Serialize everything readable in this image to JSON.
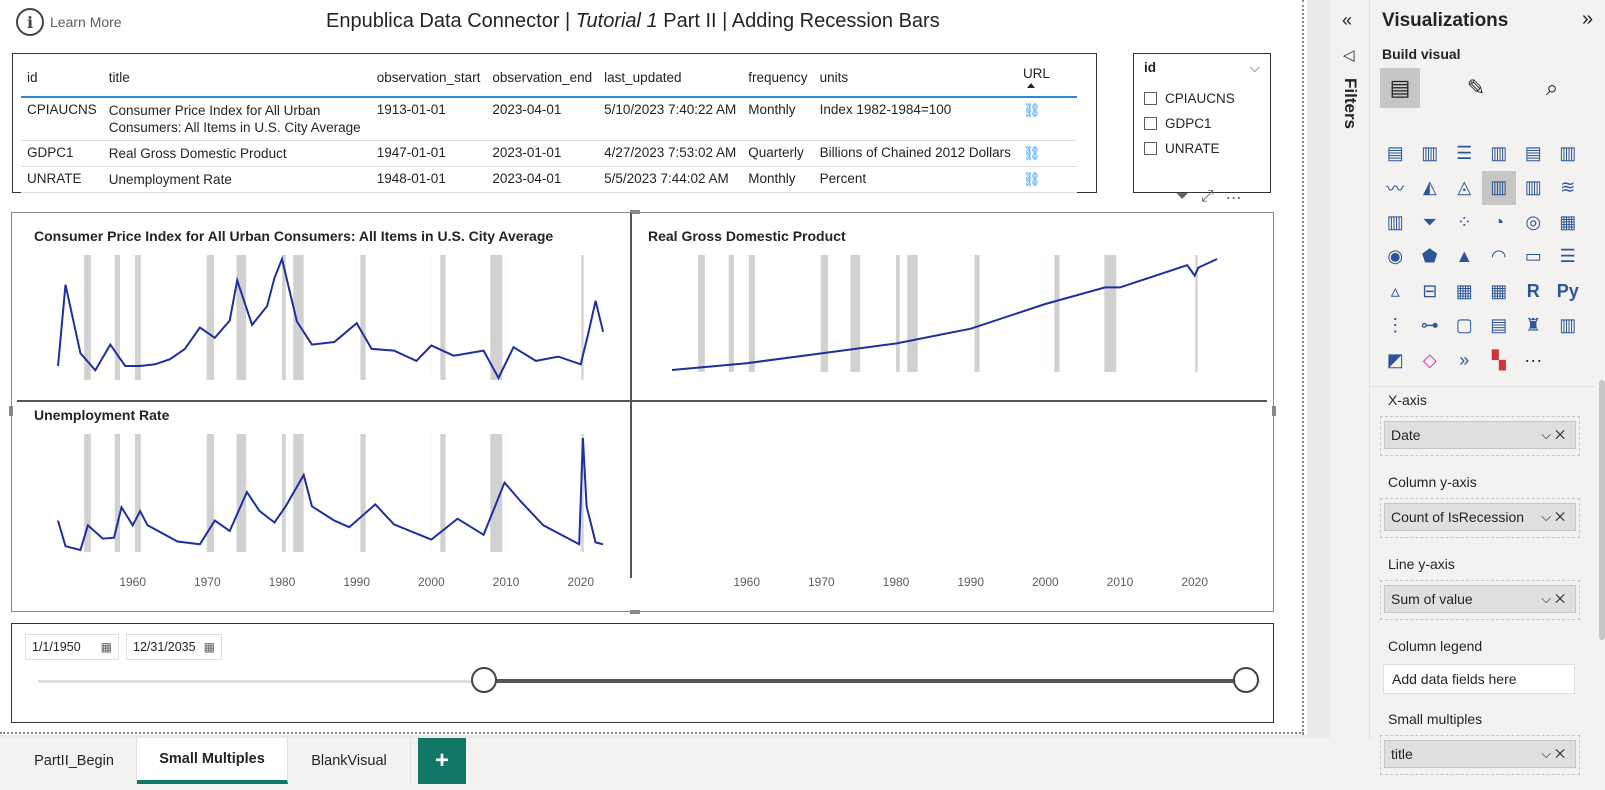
{
  "header": {
    "learn_more": "Learn More",
    "title_prefix": "Enpublica Data Connector | ",
    "title_italic": "Tutorial 1",
    "title_suffix": "  Part II | Adding Recession Bars"
  },
  "table": {
    "columns": [
      "id",
      "title",
      "observation_start",
      "observation_end",
      "last_updated",
      "frequency",
      "units",
      "URL"
    ],
    "rows": [
      {
        "id": "CPIAUCNS",
        "title": "Consumer Price Index for All Urban Consumers: All Items in U.S. City Average",
        "observation_start": "1913-01-01",
        "observation_end": "2023-04-01",
        "last_updated": "5/10/2023 7:40:22 AM",
        "frequency": "Monthly",
        "units": "Index 1982-1984=100"
      },
      {
        "id": "GDPC1",
        "title": "Real Gross Domestic Product",
        "observation_start": "1947-01-01",
        "observation_end": "2023-01-01",
        "last_updated": "4/27/2023 7:53:02 AM",
        "frequency": "Quarterly",
        "units": "Billions of Chained 2012 Dollars"
      },
      {
        "id": "UNRATE",
        "title": "Unemployment Rate",
        "observation_start": "1948-01-01",
        "observation_end": "2023-04-01",
        "last_updated": "5/5/2023 7:44:02 AM",
        "frequency": "Monthly",
        "units": "Percent"
      }
    ]
  },
  "slicer": {
    "header": "id",
    "items": [
      "CPIAUCNS",
      "GDPC1",
      "UNRATE"
    ]
  },
  "small_multiples": {
    "panel1_title": "Consumer Price Index for All Urban Consumers: All Items in U.S. City Average",
    "panel2_title": "Real Gross Domestic Product",
    "panel3_title": "Unemployment Rate"
  },
  "chart_data": {
    "type": "line",
    "x_ticks": [
      "1960",
      "1970",
      "1980",
      "1990",
      "2000",
      "2010",
      "2020"
    ],
    "xlim": [
      1950,
      2025
    ],
    "recessions": [
      [
        1953.5,
        1954.4
      ],
      [
        1957.6,
        1958.3
      ],
      [
        1960.3,
        1961.1
      ],
      [
        1969.9,
        1970.9
      ],
      [
        1973.9,
        1975.2
      ],
      [
        1980.0,
        1980.5
      ],
      [
        1981.5,
        1982.9
      ],
      [
        1990.5,
        1991.2
      ],
      [
        2001.2,
        2001.9
      ],
      [
        2007.9,
        2009.5
      ],
      [
        2020.1,
        2020.4
      ]
    ],
    "series": [
      {
        "name": "Consumer Price Index for All Urban Consumers: All Items in U.S. City Average",
        "x": [
          1950,
          1951,
          1953,
          1955,
          1957,
          1959,
          1961,
          1963,
          1965,
          1967,
          1969,
          1971,
          1973,
          1974,
          1976,
          1978,
          1979,
          1980,
          1982,
          1984,
          1987,
          1990,
          1992,
          1995,
          1998,
          2000,
          2003,
          2007,
          2009,
          2011,
          2014,
          2017,
          2020,
          2021,
          2022,
          2023
        ],
        "y": [
          1,
          10.5,
          2.5,
          0.5,
          3.5,
          1,
          1,
          1.2,
          1.8,
          3,
          5.5,
          4.3,
          6.3,
          11,
          5.8,
          8,
          11.3,
          13.5,
          6.2,
          3.5,
          3.8,
          6,
          3,
          2.8,
          1.6,
          3.4,
          2.2,
          2.8,
          -0.4,
          3.2,
          1.6,
          2.1,
          1.2,
          4.7,
          8.6,
          5
        ]
      },
      {
        "name": "Real Gross Domestic Product",
        "x": [
          1950,
          1960,
          1970,
          1980,
          1990,
          2000,
          2008,
          2010,
          2019,
          2020,
          2020.5,
          2023
        ],
        "y": [
          2.2,
          3.3,
          4.9,
          6.5,
          8.9,
          12.9,
          15.6,
          15.6,
          19.2,
          17.5,
          18.8,
          20.2
        ]
      },
      {
        "name": "Unemployment Rate",
        "x": [
          1950,
          1951,
          1953,
          1954,
          1956,
          1957.5,
          1958.5,
          1960,
          1961,
          1962,
          1966,
          1969,
          1971,
          1973,
          1975.3,
          1977,
          1979,
          1980.5,
          1982.9,
          1984,
          1987,
          1989,
          1992.5,
          1995,
          2000,
          2003.5,
          2007,
          2009.8,
          2012,
          2015,
          2019.8,
          2020.3,
          2020.8,
          2022,
          2023
        ],
        "y": [
          6,
          3.3,
          2.9,
          5.5,
          4.1,
          4.2,
          7.4,
          5.5,
          7,
          5.5,
          3.8,
          3.5,
          6,
          4.9,
          9,
          7,
          5.8,
          7.5,
          10.8,
          7.5,
          6,
          5.3,
          7.7,
          5.6,
          4,
          6.2,
          4.5,
          10,
          8,
          5.5,
          3.5,
          14.7,
          7.5,
          3.7,
          3.5
        ]
      }
    ]
  },
  "date_range": {
    "start": "1/1/1950",
    "end": "12/31/2035",
    "range_fraction": [
      0.365,
      1.0
    ]
  },
  "tabs": [
    "PartII_Begin",
    "Small Multiples",
    "BlankVisual"
  ],
  "active_tab": "Small Multiples",
  "tab_add": "+",
  "filters": {
    "label": "Filters"
  },
  "viz_pane": {
    "title": "Visualizations",
    "build_visual": "Build visual",
    "wells": [
      {
        "label": "X-axis",
        "field": "Date"
      },
      {
        "label": "Column y-axis",
        "field": "Count of IsRecession"
      },
      {
        "label": "Line y-axis",
        "field": "Sum of value"
      },
      {
        "label": "Column legend",
        "placeholder": "Add data fields here"
      },
      {
        "label": "Small multiples",
        "field": "title"
      }
    ],
    "grid_r_label": "R",
    "grid_py_label": "Py",
    "grid_more": "···"
  },
  "colors": {
    "line": "#1f2f9f",
    "recession": "#d1d1d1",
    "accent": "#117865",
    "header_underline": "#2b88d8"
  }
}
